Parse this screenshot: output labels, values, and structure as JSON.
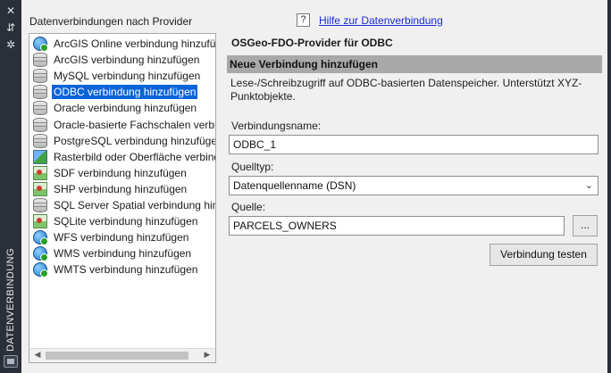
{
  "palette": {
    "strip": "#2b2f37",
    "selection": "#0a64d8",
    "link": "#1a2bd6",
    "section_bar": "#a9a9a9"
  },
  "strip": {
    "title": "DATENVERBINDUNG",
    "controls": [
      {
        "icon": "close-icon",
        "glyph": "✕"
      },
      {
        "icon": "autohide-icon",
        "glyph": "⇵"
      },
      {
        "icon": "gear-icon",
        "glyph": "✲"
      }
    ]
  },
  "providers": {
    "title": "Datenverbindungen nach Provider",
    "items": [
      {
        "label": "ArcGIS Online verbindung hinzufügen",
        "icon": "globe-icon",
        "selected": false
      },
      {
        "label": "ArcGIS verbindung hinzufügen",
        "icon": "database-icon",
        "selected": false
      },
      {
        "label": "MySQL verbindung hinzufügen",
        "icon": "database-icon",
        "selected": false
      },
      {
        "label": "ODBC verbindung hinzufügen",
        "icon": "database-icon",
        "selected": true
      },
      {
        "label": "Oracle verbindung hinzufügen",
        "icon": "database-icon",
        "selected": false
      },
      {
        "label": "Oracle-basierte Fachschalen verbindung hinzufügen",
        "icon": "database-icon",
        "selected": false
      },
      {
        "label": "PostgreSQL verbindung hinzufügen",
        "icon": "database-icon",
        "selected": false
      },
      {
        "label": "Rasterbild oder Oberfläche verbindung hinzufügen",
        "icon": "raster-icon",
        "selected": false
      },
      {
        "label": "SDF verbindung hinzufügen",
        "icon": "map-icon",
        "selected": false
      },
      {
        "label": "SHP verbindung hinzufügen",
        "icon": "map-icon",
        "selected": false
      },
      {
        "label": "SQL Server Spatial verbindung hinzufügen",
        "icon": "database-icon",
        "selected": false
      },
      {
        "label": "SQLite verbindung hinzufügen",
        "icon": "map-icon",
        "selected": false
      },
      {
        "label": "WFS verbindung hinzufügen",
        "icon": "globe-icon",
        "selected": false
      },
      {
        "label": "WMS verbindung hinzufügen",
        "icon": "globe-icon",
        "selected": false
      },
      {
        "label": "WMTS verbindung hinzufügen",
        "icon": "globe-icon",
        "selected": false
      }
    ]
  },
  "help": {
    "icon_glyph": "?",
    "link_text": "Hilfe zur Datenverbindung"
  },
  "panel": {
    "provider_heading": "OSGeo-FDO-Provider für ODBC",
    "section_title": "Neue Verbindung hinzufügen",
    "description": "Lese-/Schreibzugriff auf ODBC-basierten Datenspeicher. Unterstützt XYZ-Punktobjekte.",
    "connection_name_label": "Verbindungsname:",
    "connection_name_value": "ODBC_1",
    "source_type_label": "Quelltyp:",
    "source_type_value": "Datenquellenname (DSN)",
    "source_label": "Quelle:",
    "source_value": "PARCELS_OWNERS",
    "browse_label": "...",
    "test_button_label": "Verbindung testen"
  }
}
